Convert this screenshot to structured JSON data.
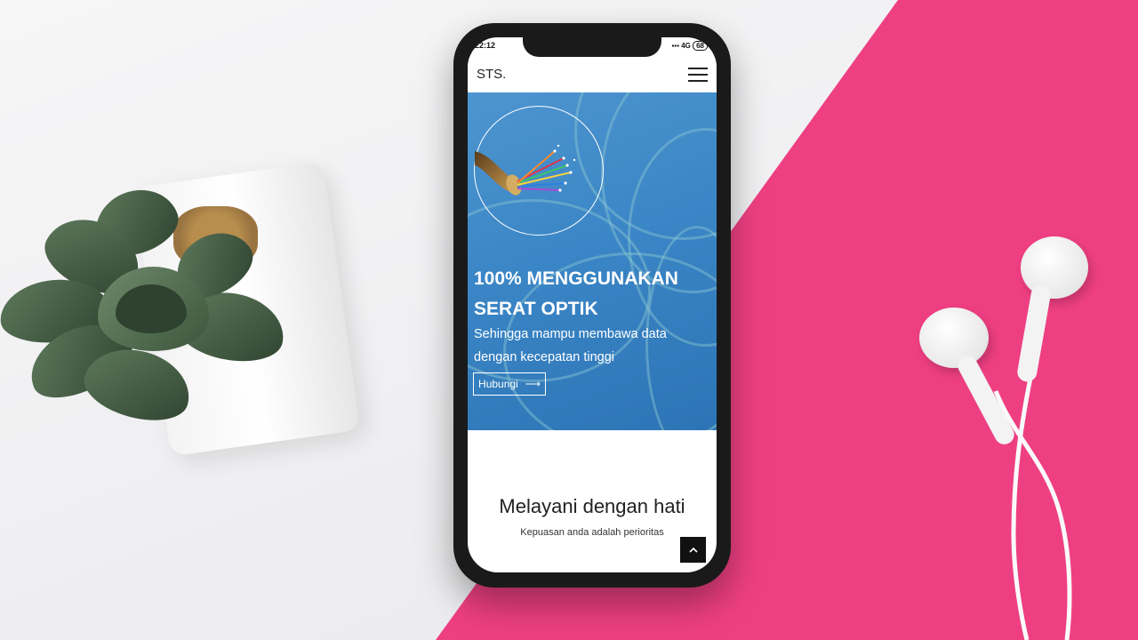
{
  "status_bar": {
    "time": "22:12",
    "network": "4G",
    "battery": "68"
  },
  "navbar": {
    "brand": "STS."
  },
  "hero": {
    "title_line1": "100% MENGGUNAKAN",
    "title_line2": "SERAT OPTIK",
    "subtitle_line1": "Sehingga mampu membawa data",
    "subtitle_line2": "dengan kecepatan tinggi",
    "button_label": "Hubungi",
    "button_arrow": "⟶"
  },
  "section": {
    "title": "Melayani dengan hati",
    "subtitle": "Kepuasan anda adalah perioritas"
  },
  "scroll_top_icon": "chevron-up-icon",
  "colors": {
    "hero_blue": "#3b86c6",
    "pink_background": "#ee3f82"
  }
}
